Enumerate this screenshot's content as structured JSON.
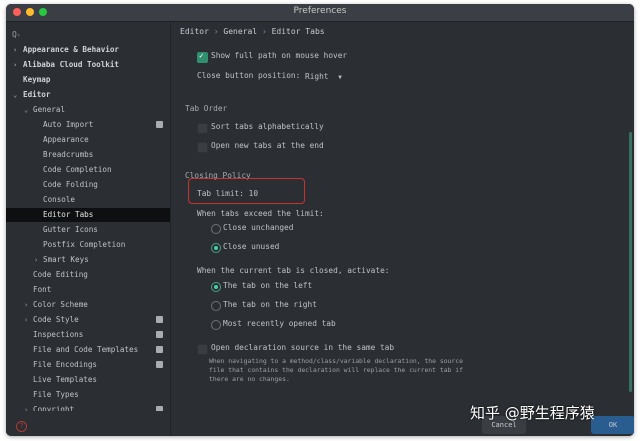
{
  "window": {
    "title": "Preferences"
  },
  "sidebar": {
    "search_icon": "search-icon",
    "items": [
      {
        "label": "Appearance & Behavior"
      },
      {
        "label": "Alibaba Cloud Toolkit"
      },
      {
        "label": "Keymap"
      },
      {
        "label": "Editor"
      },
      {
        "label": "General"
      },
      {
        "label": "Auto Import"
      },
      {
        "label": "Appearance"
      },
      {
        "label": "Breadcrumbs"
      },
      {
        "label": "Code Completion"
      },
      {
        "label": "Code Folding"
      },
      {
        "label": "Console"
      },
      {
        "label": "Editor Tabs"
      },
      {
        "label": "Gutter Icons"
      },
      {
        "label": "Postfix Completion"
      },
      {
        "label": "Smart Keys"
      },
      {
        "label": "Code Editing"
      },
      {
        "label": "Font"
      },
      {
        "label": "Color Scheme"
      },
      {
        "label": "Code Style"
      },
      {
        "label": "Inspections"
      },
      {
        "label": "File and Code Templates"
      },
      {
        "label": "File Encodings"
      },
      {
        "label": "Live Templates"
      },
      {
        "label": "File Types"
      },
      {
        "label": "Copyright"
      }
    ]
  },
  "breadcrumb": {
    "part1": "Editor",
    "sep": "›",
    "part2": "General",
    "part3": "Editor Tabs"
  },
  "settings": {
    "show_full_path": "Show full path on mouse hover",
    "close_button_position_label": "Close button position:",
    "close_button_position_value": "Right",
    "tab_order_title": "Tab Order",
    "sort_tabs": "Sort tabs alphabetically",
    "open_new_tabs_end": "Open new tabs at the end",
    "closing_policy_title": "Closing Policy",
    "tab_limit_label": "Tab limit:",
    "tab_limit_value": "10",
    "when_exceed": "When tabs exceed the limit:",
    "close_unchanged": "Close unchanged",
    "close_unused": "Close unused",
    "when_closed": "When the current tab is closed, activate:",
    "tab_left": "The tab on the left",
    "tab_right": "The tab on the right",
    "most_recent": "Most recently opened tab",
    "open_decl": "Open declaration source in the same tab",
    "hint_line1": "When navigating to a method/class/variable declaration, the source",
    "hint_line2": "file that contains the declaration will replace the current tab if",
    "hint_line3": "there are no changes."
  },
  "buttons": {
    "cancel": "Cancel",
    "ok": "OK"
  },
  "watermark": "知乎 @野生程序猿",
  "colors": {
    "accent": "#46d0a8",
    "highlight_box": "#c9332d",
    "background": "#2b2e33"
  }
}
